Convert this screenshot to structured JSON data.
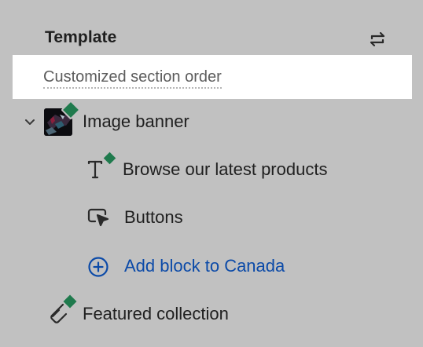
{
  "panel": {
    "title": "Template",
    "customized_note": "Customized section order"
  },
  "sections": [
    {
      "label": "Image banner",
      "icon": "image-thumbnail",
      "expanded": true,
      "blocks": [
        {
          "label": "Browse our latest products",
          "icon": "text-icon"
        },
        {
          "label": "Buttons",
          "icon": "button-cursor-icon"
        }
      ],
      "add_block_label": "Add block to Canada"
    },
    {
      "label": "Featured collection",
      "icon": "tag-icon"
    }
  ],
  "colors": {
    "background": "#c1c1c1",
    "highlight": "#ffffff",
    "link": "#0b4aa8",
    "badge": "#1f7a4d"
  }
}
